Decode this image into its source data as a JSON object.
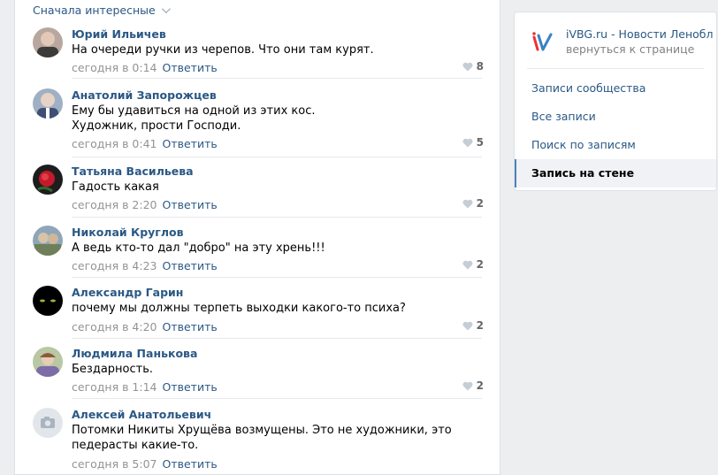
{
  "sort": {
    "label": "Сначала интересные"
  },
  "comments": [
    {
      "author": "Юрий Ильичев",
      "text": "На очереди ручки из черепов. Что они там курят.",
      "time": "сегодня в 0:14",
      "reply": "Ответить",
      "likes": "8"
    },
    {
      "author": "Анатолий Запорожцев",
      "text": "Ему бы удавиться на одной из этих кос.\nХудожник, прости Господи.",
      "time": "сегодня в 0:41",
      "reply": "Ответить",
      "likes": "5"
    },
    {
      "author": "Татьяна Васильева",
      "text": "Гадость какая",
      "time": "сегодня в 2:20",
      "reply": "Ответить",
      "likes": "2"
    },
    {
      "author": "Николай Круглов",
      "text": "А ведь кто-то дал \"добро\" на эту хрень!!!",
      "time": "сегодня в 4:23",
      "reply": "Ответить",
      "likes": "2"
    },
    {
      "author": "Александр Гарин",
      "text": "почему мы должны терпеть выходки какого-то психа?",
      "time": "сегодня в 4:20",
      "reply": "Ответить",
      "likes": "2"
    },
    {
      "author": "Людмила Панькова",
      "text": "Бездарность.",
      "time": "сегодня в 1:14",
      "reply": "Ответить",
      "likes": "2"
    },
    {
      "author": "Алексей Анатольевич",
      "text": "Потомки Никиты Хрущёва возмущены. Это не художники, это педерасты какие-то.",
      "time": "сегодня в 5:07",
      "reply": "Ответить",
      "likes": ""
    }
  ],
  "sidebar": {
    "group_title": "iVBG.ru - Новости Ленобл",
    "group_back": "вернуться к странице",
    "nav": [
      "Записи сообщества",
      "Все записи",
      "Поиск по записям",
      "Запись на стене"
    ]
  },
  "colors": {
    "link": "#2a5885",
    "muted": "#939393",
    "background": "#edeef0"
  }
}
